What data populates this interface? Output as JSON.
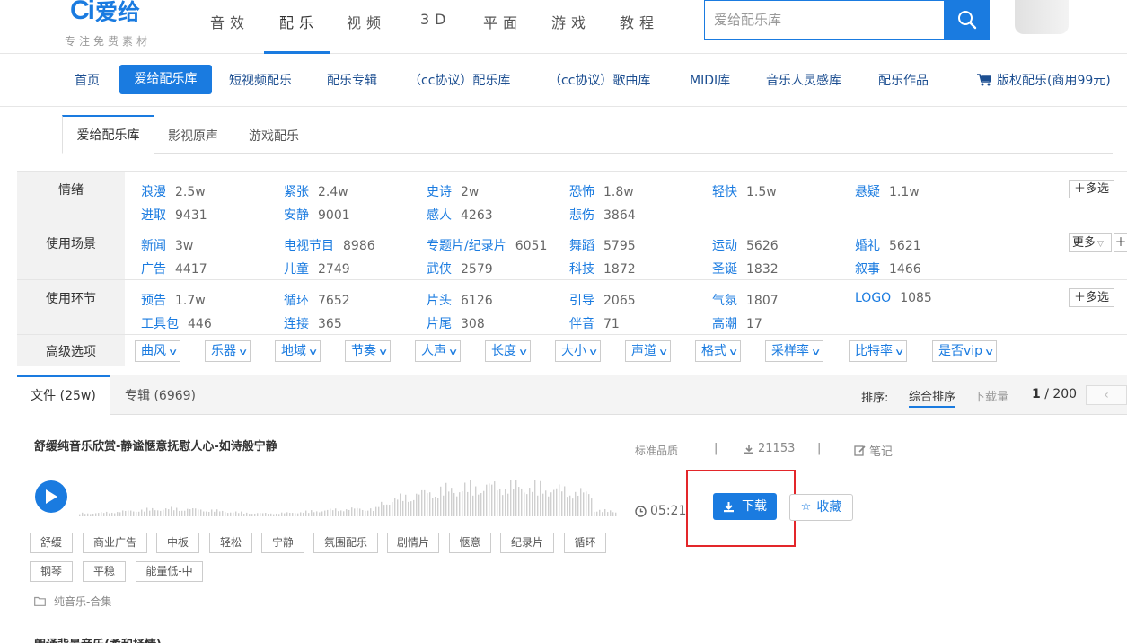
{
  "header": {
    "logo_mark": "Ci",
    "logo_text": "爱给",
    "slogan": "专注免费素材",
    "nav": [
      "音效",
      "配乐",
      "视频",
      "3D",
      "平面",
      "游戏",
      "教程"
    ],
    "active_nav": "配乐",
    "search_placeholder": "爱给配乐库"
  },
  "subnav": {
    "items": [
      "首页",
      "爱给配乐库",
      "短视频配乐",
      "配乐专辑",
      "（cc协议）配乐库",
      "（cc协议）歌曲库",
      "MIDI库",
      "音乐人灵感库",
      "配乐作品",
      "版权配乐(商用99元)"
    ],
    "active": "爱给配乐库"
  },
  "tabs": [
    "爱给配乐库",
    "影视原声",
    "游戏配乐"
  ],
  "filters": {
    "mood": {
      "label": "情绪",
      "items": [
        {
          "k": "浪漫",
          "v": "2.5w"
        },
        {
          "k": "紧张",
          "v": "2.4w"
        },
        {
          "k": "史诗",
          "v": "2w"
        },
        {
          "k": "恐怖",
          "v": "1.8w"
        },
        {
          "k": "轻快",
          "v": "1.5w"
        },
        {
          "k": "悬疑",
          "v": "1.1w"
        },
        {
          "k": "进取",
          "v": "9431"
        },
        {
          "k": "安静",
          "v": "9001"
        },
        {
          "k": "感人",
          "v": "4263"
        },
        {
          "k": "悲伤",
          "v": "3864"
        }
      ],
      "button": "多选"
    },
    "scene": {
      "label": "使用场景",
      "items": [
        {
          "k": "新闻",
          "v": "3w"
        },
        {
          "k": "电视节目",
          "v": "8986"
        },
        {
          "k": "专题片/纪录片",
          "v": "6051"
        },
        {
          "k": "舞蹈",
          "v": "5795"
        },
        {
          "k": "运动",
          "v": "5626"
        },
        {
          "k": "婚礼",
          "v": "5621"
        },
        {
          "k": "广告",
          "v": "4417"
        },
        {
          "k": "儿童",
          "v": "2749"
        },
        {
          "k": "武侠",
          "v": "2579"
        },
        {
          "k": "科技",
          "v": "1872"
        },
        {
          "k": "圣诞",
          "v": "1832"
        },
        {
          "k": "叙事",
          "v": "1466"
        }
      ],
      "button": "更多"
    },
    "segment": {
      "label": "使用环节",
      "items": [
        {
          "k": "预告",
          "v": "1.7w"
        },
        {
          "k": "循环",
          "v": "7652"
        },
        {
          "k": "片头",
          "v": "6126"
        },
        {
          "k": "引导",
          "v": "2065"
        },
        {
          "k": "气氛",
          "v": "1807"
        },
        {
          "k": "LOGO",
          "v": "1085"
        },
        {
          "k": "工具包",
          "v": "446"
        },
        {
          "k": "连接",
          "v": "365"
        },
        {
          "k": "片尾",
          "v": "308"
        },
        {
          "k": "伴音",
          "v": "71"
        },
        {
          "k": "高潮",
          "v": "17"
        }
      ],
      "button": "多选"
    },
    "advanced": {
      "label": "高级选项",
      "dropdowns": [
        "曲风",
        "乐器",
        "地域",
        "节奏",
        "人声",
        "长度",
        "大小",
        "声道",
        "格式",
        "采样率",
        "比特率",
        "是否vip"
      ]
    }
  },
  "list": {
    "tab_files": "文件 (25w)",
    "tab_albums": "专辑 (6969)",
    "sort_label": "排序:",
    "sort_active": "综合排序",
    "sort_other": "下载量",
    "page_current": "1",
    "page_total": "/ 200"
  },
  "track": {
    "title": "舒缓纯音乐欣赏-静谧惬意抚慰人心-如诗般宁静",
    "quality": "标准品质",
    "sep": "|",
    "downloads": "21153",
    "note": "笔记",
    "duration": "05:21",
    "download_label": "下载",
    "favorite_label": "收藏",
    "tags": [
      "舒缓",
      "商业广告",
      "中板",
      "轻松",
      "宁静",
      "氛围配乐",
      "剧情片",
      "惬意",
      "纪录片",
      "循环",
      "钢琴",
      "平稳",
      "能量低-中"
    ],
    "folder": "纯音乐-合集"
  },
  "next_track_title": "朗诵背景音乐(柔和抒情)",
  "colors": {
    "accent": "#1a7be0",
    "highlight_box": "#e3262a"
  }
}
